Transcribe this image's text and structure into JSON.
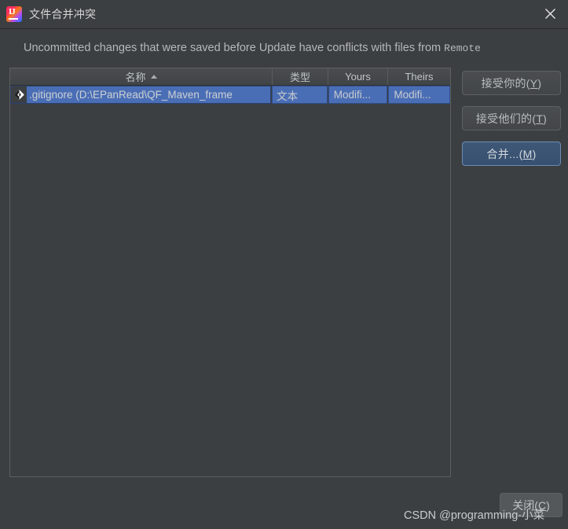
{
  "window": {
    "title": "文件合并冲突",
    "app_icon": "intellij-idea-icon",
    "close_icon": "close-icon"
  },
  "message": {
    "text_before": "Uncommitted changes that were saved before Update have conflicts with files from ",
    "source": "Remote"
  },
  "table": {
    "columns": [
      {
        "label": "名称",
        "sorted": true,
        "sort_direction": "ascending"
      },
      {
        "label": "类型",
        "sorted": false
      },
      {
        "label": "Yours",
        "sorted": false
      },
      {
        "label": "Theirs",
        "sorted": false
      }
    ],
    "rows": [
      {
        "icon": "git-file-icon",
        "name": ".gitignore (D:\\EPanRead\\QF_Maven_frame",
        "type": "文本",
        "yours": "Modifi...",
        "theirs": "Modifi...",
        "selected": true
      }
    ]
  },
  "actions": {
    "accept_yours": "接受你的(Y)",
    "accept_yours_mnemonic": "Y",
    "accept_theirs": "接受他们的(T)",
    "accept_theirs_mnemonic": "T",
    "merge": "合并...(M)",
    "merge_mnemonic": "M",
    "close": "关闭(C)",
    "close_mnemonic": "C"
  },
  "watermark": {
    "text": "CSDN @programming-小菜"
  },
  "colors": {
    "window_background": "#3c3f41",
    "selection_blue": "#4a6eb5",
    "default_button_blue": "#3f5878",
    "border": "#5c5e60",
    "text": "#bbbbbb"
  }
}
